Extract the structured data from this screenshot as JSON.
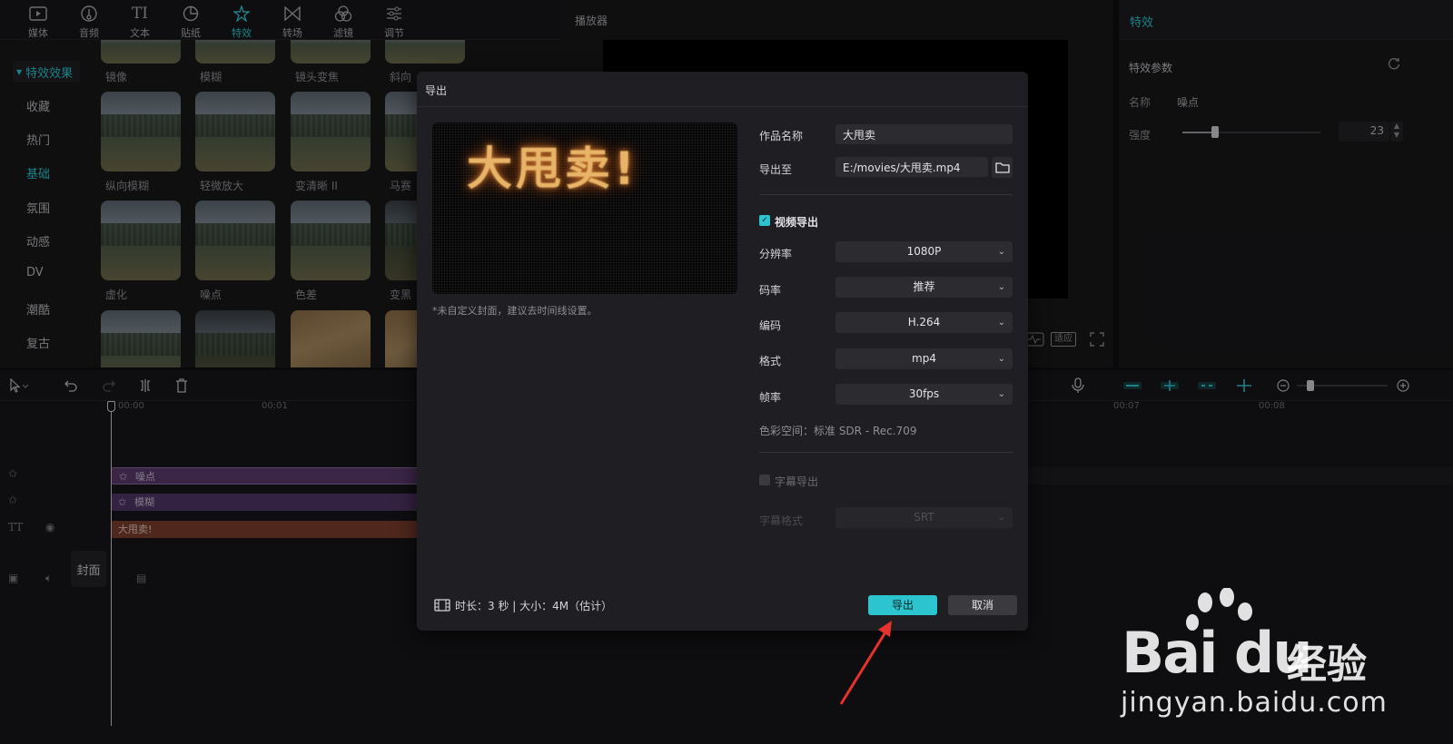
{
  "top_tabs": [
    {
      "label": "媒体",
      "icon": "media-icon"
    },
    {
      "label": "音频",
      "icon": "audio-icon"
    },
    {
      "label": "文本",
      "icon": "text-icon"
    },
    {
      "label": "贴纸",
      "icon": "sticker-icon"
    },
    {
      "label": "特效",
      "icon": "effects-icon",
      "active": true
    },
    {
      "label": "转场",
      "icon": "transition-icon"
    },
    {
      "label": "滤镜",
      "icon": "filter-icon"
    },
    {
      "label": "调节",
      "icon": "adjust-icon"
    }
  ],
  "categories": {
    "header": "特效效果",
    "items": [
      "收藏",
      "热门",
      "基础",
      "氛围",
      "动感",
      "DV",
      "潮酷",
      "复古"
    ],
    "active": "基础"
  },
  "thumbnails": {
    "row0": [
      "镜像",
      "模糊",
      "镜头变焦",
      "斜向"
    ],
    "row1": [
      "纵向模糊",
      "轻微放大",
      "变清晰 II",
      "马赛"
    ],
    "row2": [
      "虚化",
      "噪点",
      "色差",
      "变黑"
    ]
  },
  "player": {
    "title": "播放器",
    "fit_label": "适应"
  },
  "effects_panel": {
    "title": "特效",
    "params_title": "特效参数",
    "name_label": "名称",
    "name_value": "噪点",
    "strength_label": "强度",
    "strength_value": "23"
  },
  "timeline": {
    "ruler": [
      "00:00",
      "00:01",
      "00:07",
      "00:08"
    ],
    "tracks": [
      {
        "label": "噪点",
        "type": "effect"
      },
      {
        "label": "模糊",
        "type": "effect"
      },
      {
        "label": "大甩卖!",
        "type": "text"
      }
    ],
    "cover_label": "封面"
  },
  "dialog": {
    "title": "导出",
    "preview_text": "大甩卖!",
    "cover_hint": "*未自定义封面，建议去时间线设置。",
    "work_name_label": "作品名称",
    "work_name_value": "大甩卖",
    "export_to_label": "导出至",
    "export_to_value": "E:/movies/大甩卖.mp4",
    "video_export_label": "视频导出",
    "video_export_checked": true,
    "resolution_label": "分辨率",
    "resolution_value": "1080P",
    "bitrate_label": "码率",
    "bitrate_value": "推荐",
    "codec_label": "编码",
    "codec_value": "H.264",
    "format_label": "格式",
    "format_value": "mp4",
    "framerate_label": "帧率",
    "framerate_value": "30fps",
    "colorspace_text": "色彩空间：标准 SDR - Rec.709",
    "subtitle_export_label": "字幕导出",
    "subtitle_export_checked": false,
    "subtitle_format_label": "字幕格式",
    "subtitle_format_value": "SRT",
    "duration_info": "时长：3 秒 | 大小：4M（估计）",
    "export_button": "导出",
    "cancel_button": "取消"
  },
  "watermark": {
    "brand": "Bai du",
    "brand_cn": "经验",
    "url": "jingyan.baidu.com"
  },
  "colors": {
    "accent": "#2cc5cf",
    "arrow": "#e5322c"
  }
}
